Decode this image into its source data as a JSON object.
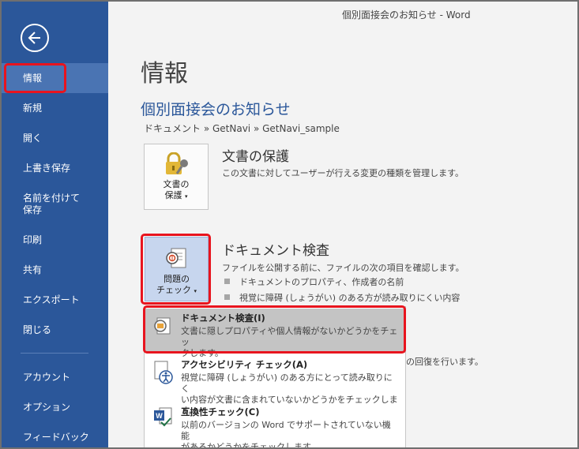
{
  "window": {
    "title": "個別面接会のお知らせ - Word"
  },
  "nav": {
    "back_icon": "back-arrow-icon",
    "items": [
      {
        "label": "情報"
      },
      {
        "label": "新規"
      },
      {
        "label": "開く"
      },
      {
        "label": "上書き保存"
      },
      {
        "label": "名前を付けて",
        "label2": "保存"
      },
      {
        "label": "印刷"
      },
      {
        "label": "共有"
      },
      {
        "label": "エクスポート"
      },
      {
        "label": "閉じる"
      },
      {
        "label": "アカウント"
      },
      {
        "label": "オプション"
      },
      {
        "label": "フィードバック"
      }
    ],
    "active": "情報"
  },
  "main": {
    "title": "情報",
    "doc_title": "個別面接会のお知らせ",
    "breadcrumb": "ドキュメント » GetNavi » GetNavi_sample",
    "protect": {
      "button_line1": "文書の",
      "button_line2": "保護",
      "heading": "文書の保護",
      "desc": "この文書に対してユーザーが行える変更の種類を管理します。"
    },
    "inspect": {
      "button_line1": "問題の",
      "button_line2": "チェック",
      "heading": "ドキュメント検査",
      "desc": "ファイルを公開する前に、ファイルの次の項目を確認します。",
      "bullets": [
        "ドキュメントのプロパティ、作成者の名前",
        "視覚に障碍 (しょうがい) のある方が読み取りにくい内容"
      ]
    },
    "versions_desc_tail": "の回復を行います。"
  },
  "menu": {
    "items": [
      {
        "title": "ドキュメント検査(I)",
        "desc1": "文書に隠しプロパティや個人情報がないかどうかをチェッ",
        "desc2": "クします。",
        "icon": "document-inspect-icon"
      },
      {
        "title": "アクセシビリティ チェック(A)",
        "desc1": "視覚に障碍 (しょうがい) のある方にとって読み取りにく",
        "desc2": "い内容が文書に含まれていないかどうかをチェックします。",
        "icon": "accessibility-icon"
      },
      {
        "title": "互換性チェック(C)",
        "desc1": "以前のバージョンの Word でサポートされていない機能",
        "desc2": "があるかどうかをチェックします。",
        "icon": "compatibility-icon"
      }
    ]
  },
  "colors": {
    "nav_bg": "#2b579a",
    "nav_active": "#4a74b3",
    "highlight_red": "#e8141e",
    "accent_blue": "#2b579a"
  }
}
